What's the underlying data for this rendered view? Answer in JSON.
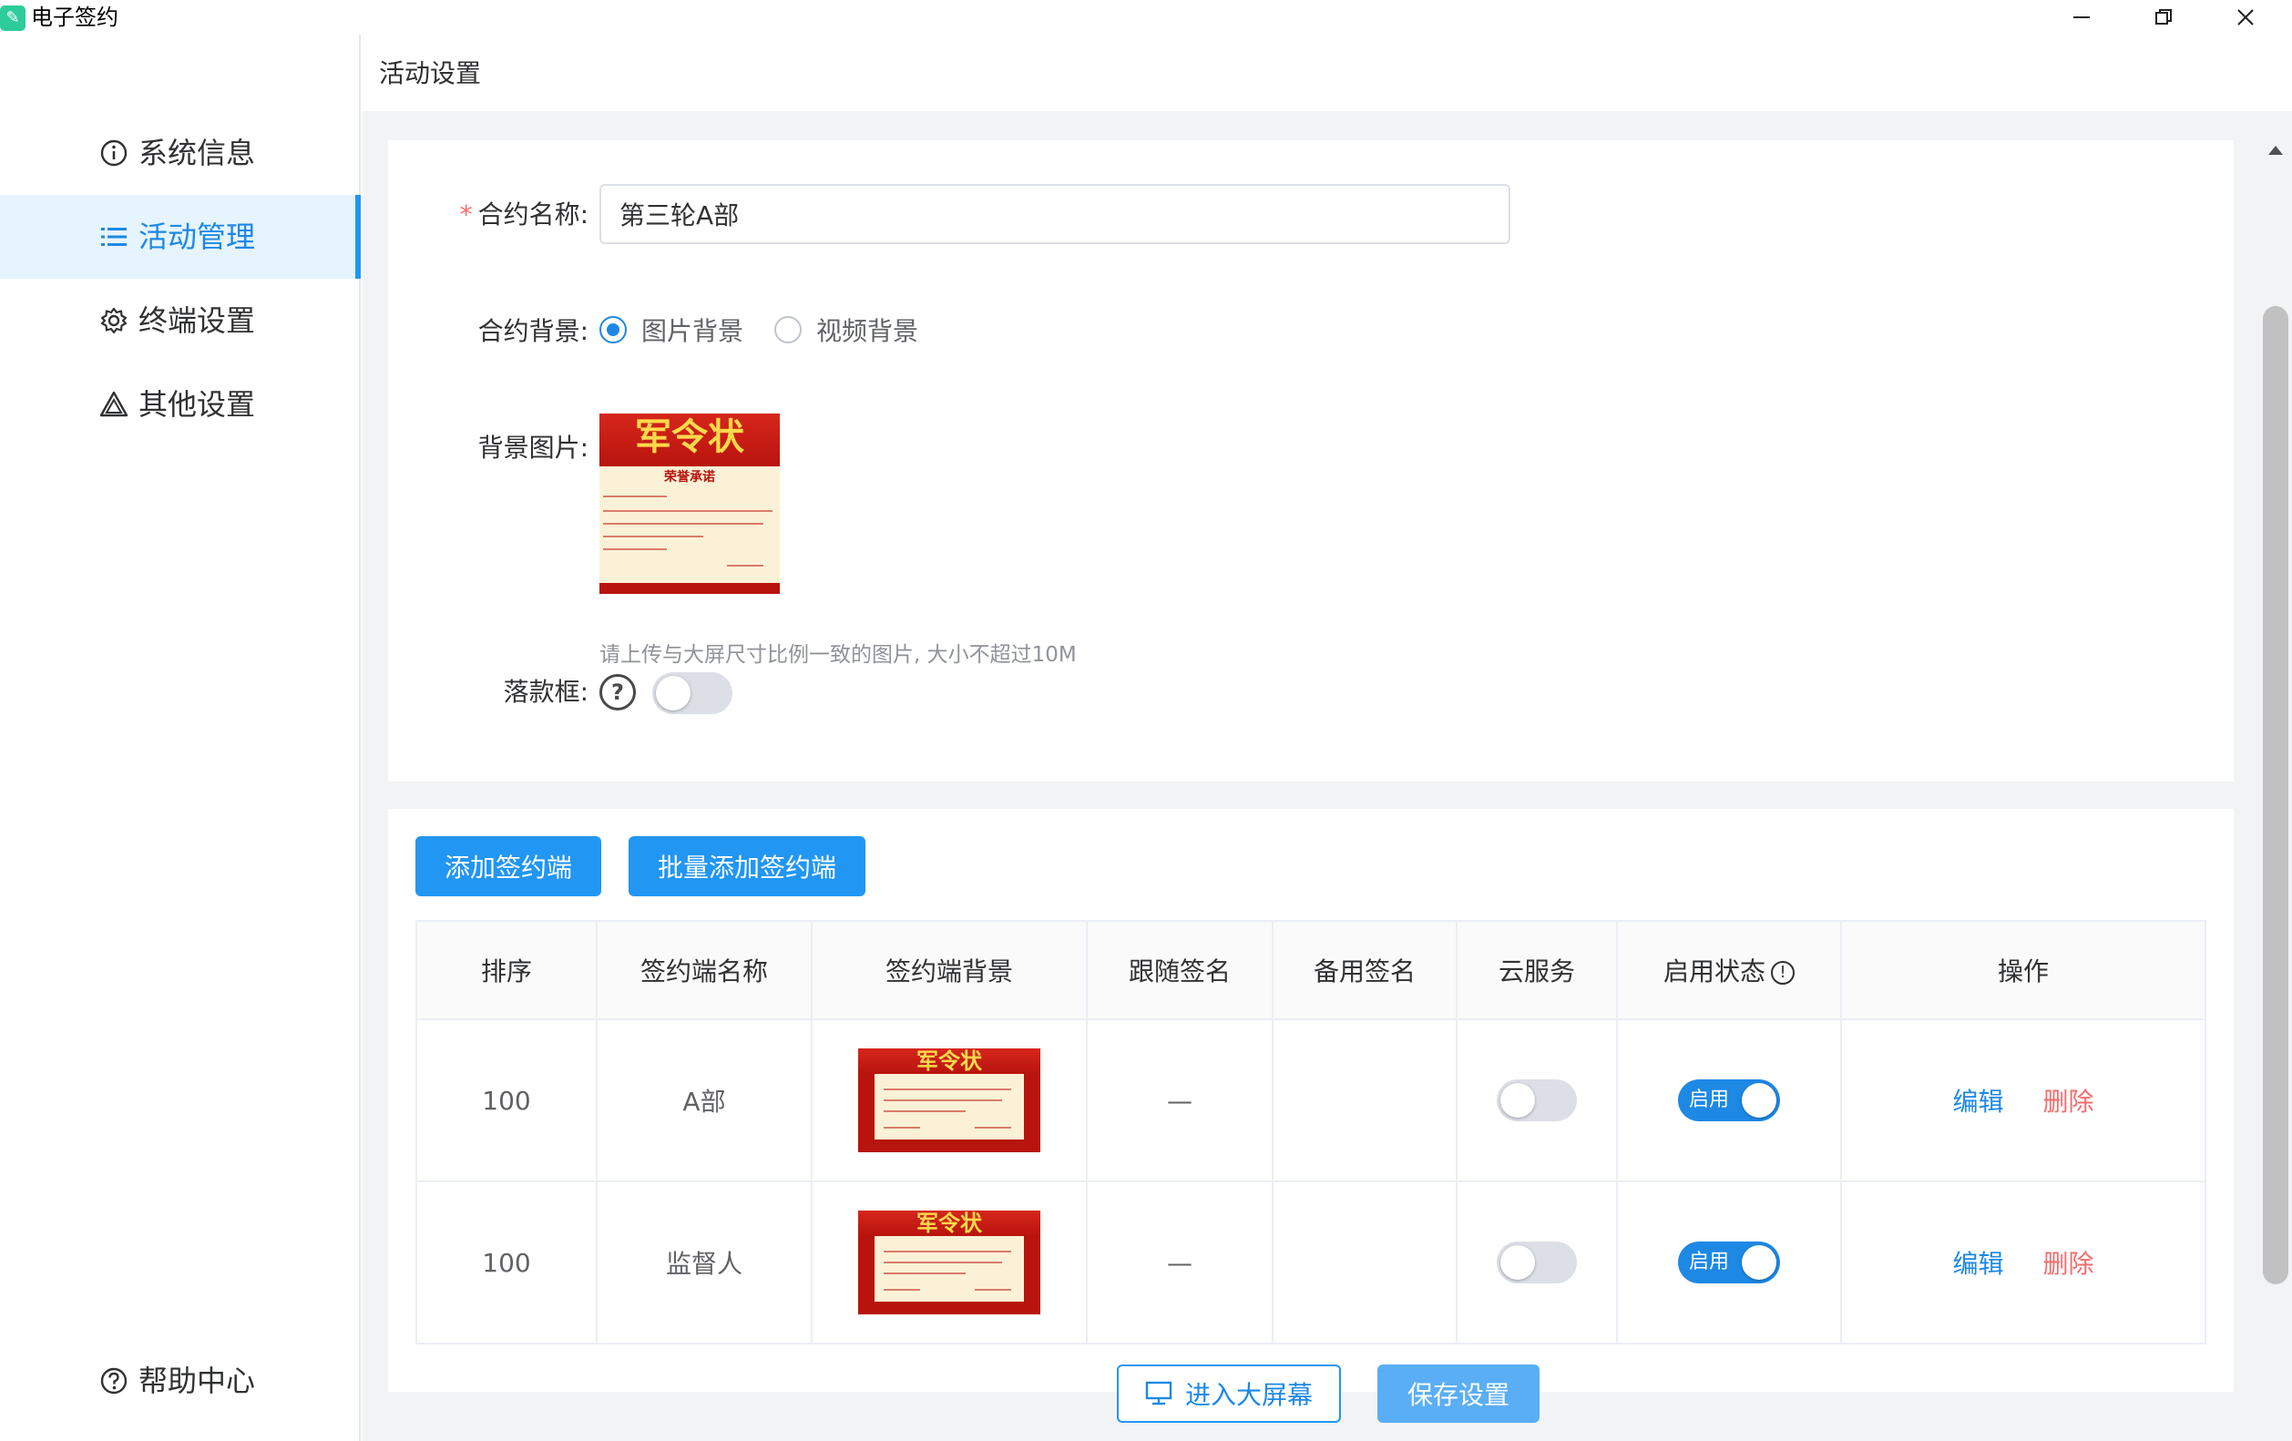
{
  "window": {
    "title": "电子签约",
    "logo_glyph": "✎"
  },
  "sidebar": {
    "items": [
      {
        "label": "系统信息",
        "icon": "info-circle-icon"
      },
      {
        "label": "活动管理",
        "icon": "list-icon",
        "active": true
      },
      {
        "label": "终端设置",
        "icon": "gear-icon"
      },
      {
        "label": "其他设置",
        "icon": "warning-triangle-icon"
      }
    ],
    "help": {
      "label": "帮助中心",
      "icon": "question-circle-icon"
    }
  },
  "page": {
    "title": "活动设置"
  },
  "form": {
    "contract_name": {
      "label": "合约名称:",
      "required_mark": "*",
      "value": "第三轮A部"
    },
    "background": {
      "label": "合约背景:",
      "options": [
        {
          "label": "图片背景",
          "selected": true
        },
        {
          "label": "视频背景",
          "selected": false
        }
      ]
    },
    "bg_image": {
      "label": "背景图片:",
      "thumb_title": "军令状",
      "thumb_subtitle": "荣誉承诺",
      "hint": "请上传与大屏尺寸比例一致的图片, 大小不超过10M"
    },
    "signature_box": {
      "label": "落款框:",
      "help_glyph": "?",
      "enabled": false
    }
  },
  "actions": {
    "add_terminal": "添加签约端",
    "batch_add_terminal": "批量添加签约端"
  },
  "table": {
    "headers": [
      "排序",
      "签约端名称",
      "签约端背景",
      "跟随签名",
      "备用签名",
      "云服务",
      "启用状态",
      "操作"
    ],
    "status_info_glyph": "!",
    "rows": [
      {
        "order": "100",
        "name": "A部",
        "bg_title": "军令状",
        "follow_sign": "—",
        "backup_sign": "",
        "cloud": false,
        "status_label": "启用",
        "edit": "编辑",
        "delete": "删除"
      },
      {
        "order": "100",
        "name": "监督人",
        "bg_title": "军令状",
        "follow_sign": "—",
        "backup_sign": "",
        "cloud": false,
        "status_label": "启用",
        "edit": "编辑",
        "delete": "删除"
      }
    ]
  },
  "footer": {
    "enter_screen": "进入大屏幕",
    "save": "保存设置"
  },
  "colors": {
    "accent": "#2196f3",
    "danger": "#f56c6c",
    "active_bg": "#e6f4fd"
  }
}
